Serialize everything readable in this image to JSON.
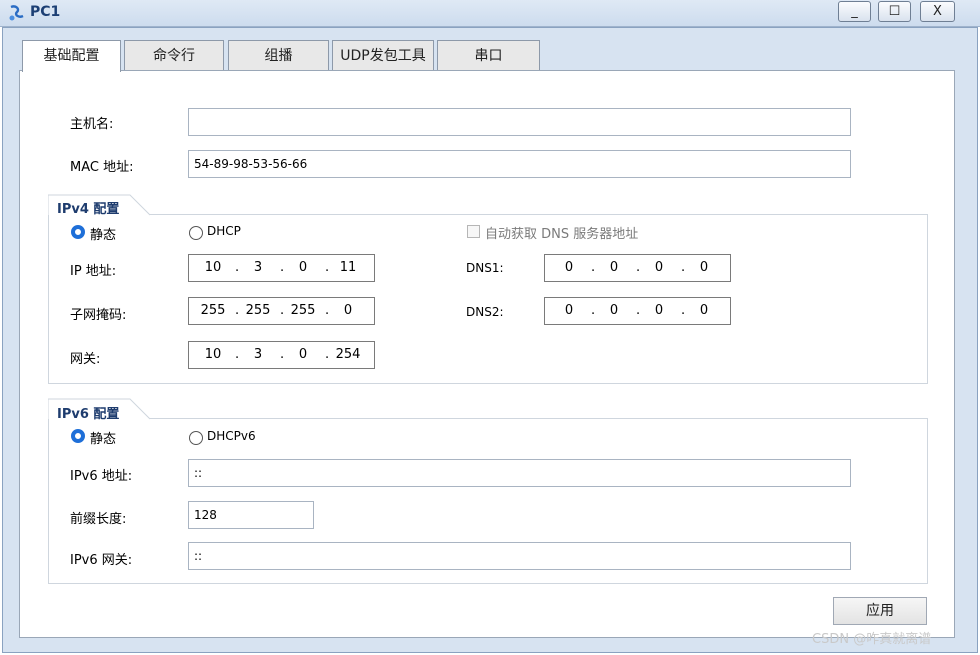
{
  "window": {
    "title": "PC1",
    "min_glyph": "_",
    "max_glyph": "☐",
    "close_glyph": "X"
  },
  "tabs": [
    {
      "label": "基础配置",
      "active": true
    },
    {
      "label": "命令行",
      "active": false
    },
    {
      "label": "组播",
      "active": false
    },
    {
      "label": "UDP发包工具",
      "active": false
    },
    {
      "label": "串口",
      "active": false
    }
  ],
  "basic": {
    "hostname_label": "主机名:",
    "hostname_value": "",
    "mac_label": "MAC 地址:",
    "mac_value": "54-89-98-53-56-66"
  },
  "ipv4": {
    "group_label": "IPv4 配置",
    "static_label": "静态",
    "dhcp_label": "DHCP",
    "mode": "static",
    "auto_dns_label": "自动获取 DNS 服务器地址",
    "auto_dns_checked": false,
    "ip_label": "IP 地址:",
    "ip": [
      "10",
      "3",
      "0",
      "11"
    ],
    "mask_label": "子网掩码:",
    "mask": [
      "255",
      "255",
      "255",
      "0"
    ],
    "gateway_label": "网关:",
    "gateway": [
      "10",
      "3",
      "0",
      "254"
    ],
    "dns1_label": "DNS1:",
    "dns1": [
      "0",
      "0",
      "0",
      "0"
    ],
    "dns2_label": "DNS2:",
    "dns2": [
      "0",
      "0",
      "0",
      "0"
    ]
  },
  "ipv6": {
    "group_label": "IPv6 配置",
    "static_label": "静态",
    "dhcp_label": "DHCPv6",
    "mode": "static",
    "addr_label": "IPv6 地址:",
    "addr_value": "::",
    "prefix_label": "前缀长度:",
    "prefix_value": "128",
    "gateway_label": "IPv6 网关:",
    "gateway_value": "::"
  },
  "apply_label": "应用",
  "watermark": "CSDN @咋真就离谱",
  "colors": {
    "accent": "#1e6fd8",
    "title_text": "#1c3f74",
    "frame": "#d7e3f1"
  }
}
